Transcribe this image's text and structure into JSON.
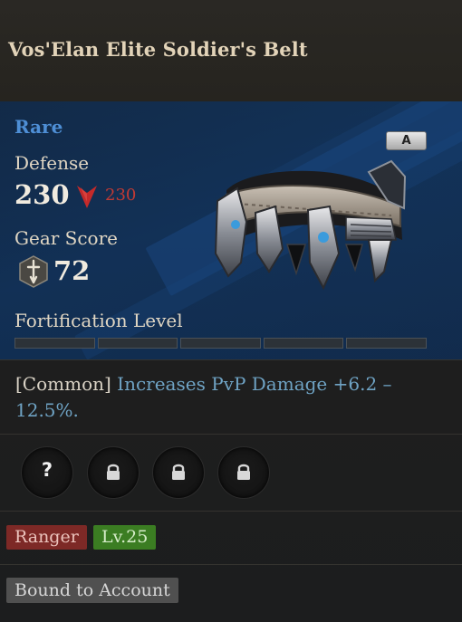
{
  "item": {
    "name": "Vos'Elan Elite Soldier's Belt",
    "rarity": "Rare",
    "grade": "A",
    "defense_label": "Defense",
    "defense_value": "230",
    "defense_compare": "230",
    "gear_score_label": "Gear Score",
    "gear_score_value": "72",
    "fortification_label": "Fortification Level",
    "fortification_filled": 0,
    "fortification_total": 5
  },
  "effect": {
    "tier": "[Common]",
    "description": "Increases PvP Damage +6.2 – 12.5%."
  },
  "sockets": {
    "unknown_symbol": "?",
    "slots": [
      "unknown-icon",
      "lock-icon",
      "lock-icon",
      "lock-icon"
    ]
  },
  "tags": {
    "class": "Ranger",
    "level": "Lv.25"
  },
  "binding": "Bound to Account",
  "colors": {
    "rarity": "#4e8fd6",
    "compare_down": "#c23a34",
    "effect_desc": "#6fa3c4",
    "class_tag": "#7d2926",
    "level_tag": "#3b7d22"
  }
}
